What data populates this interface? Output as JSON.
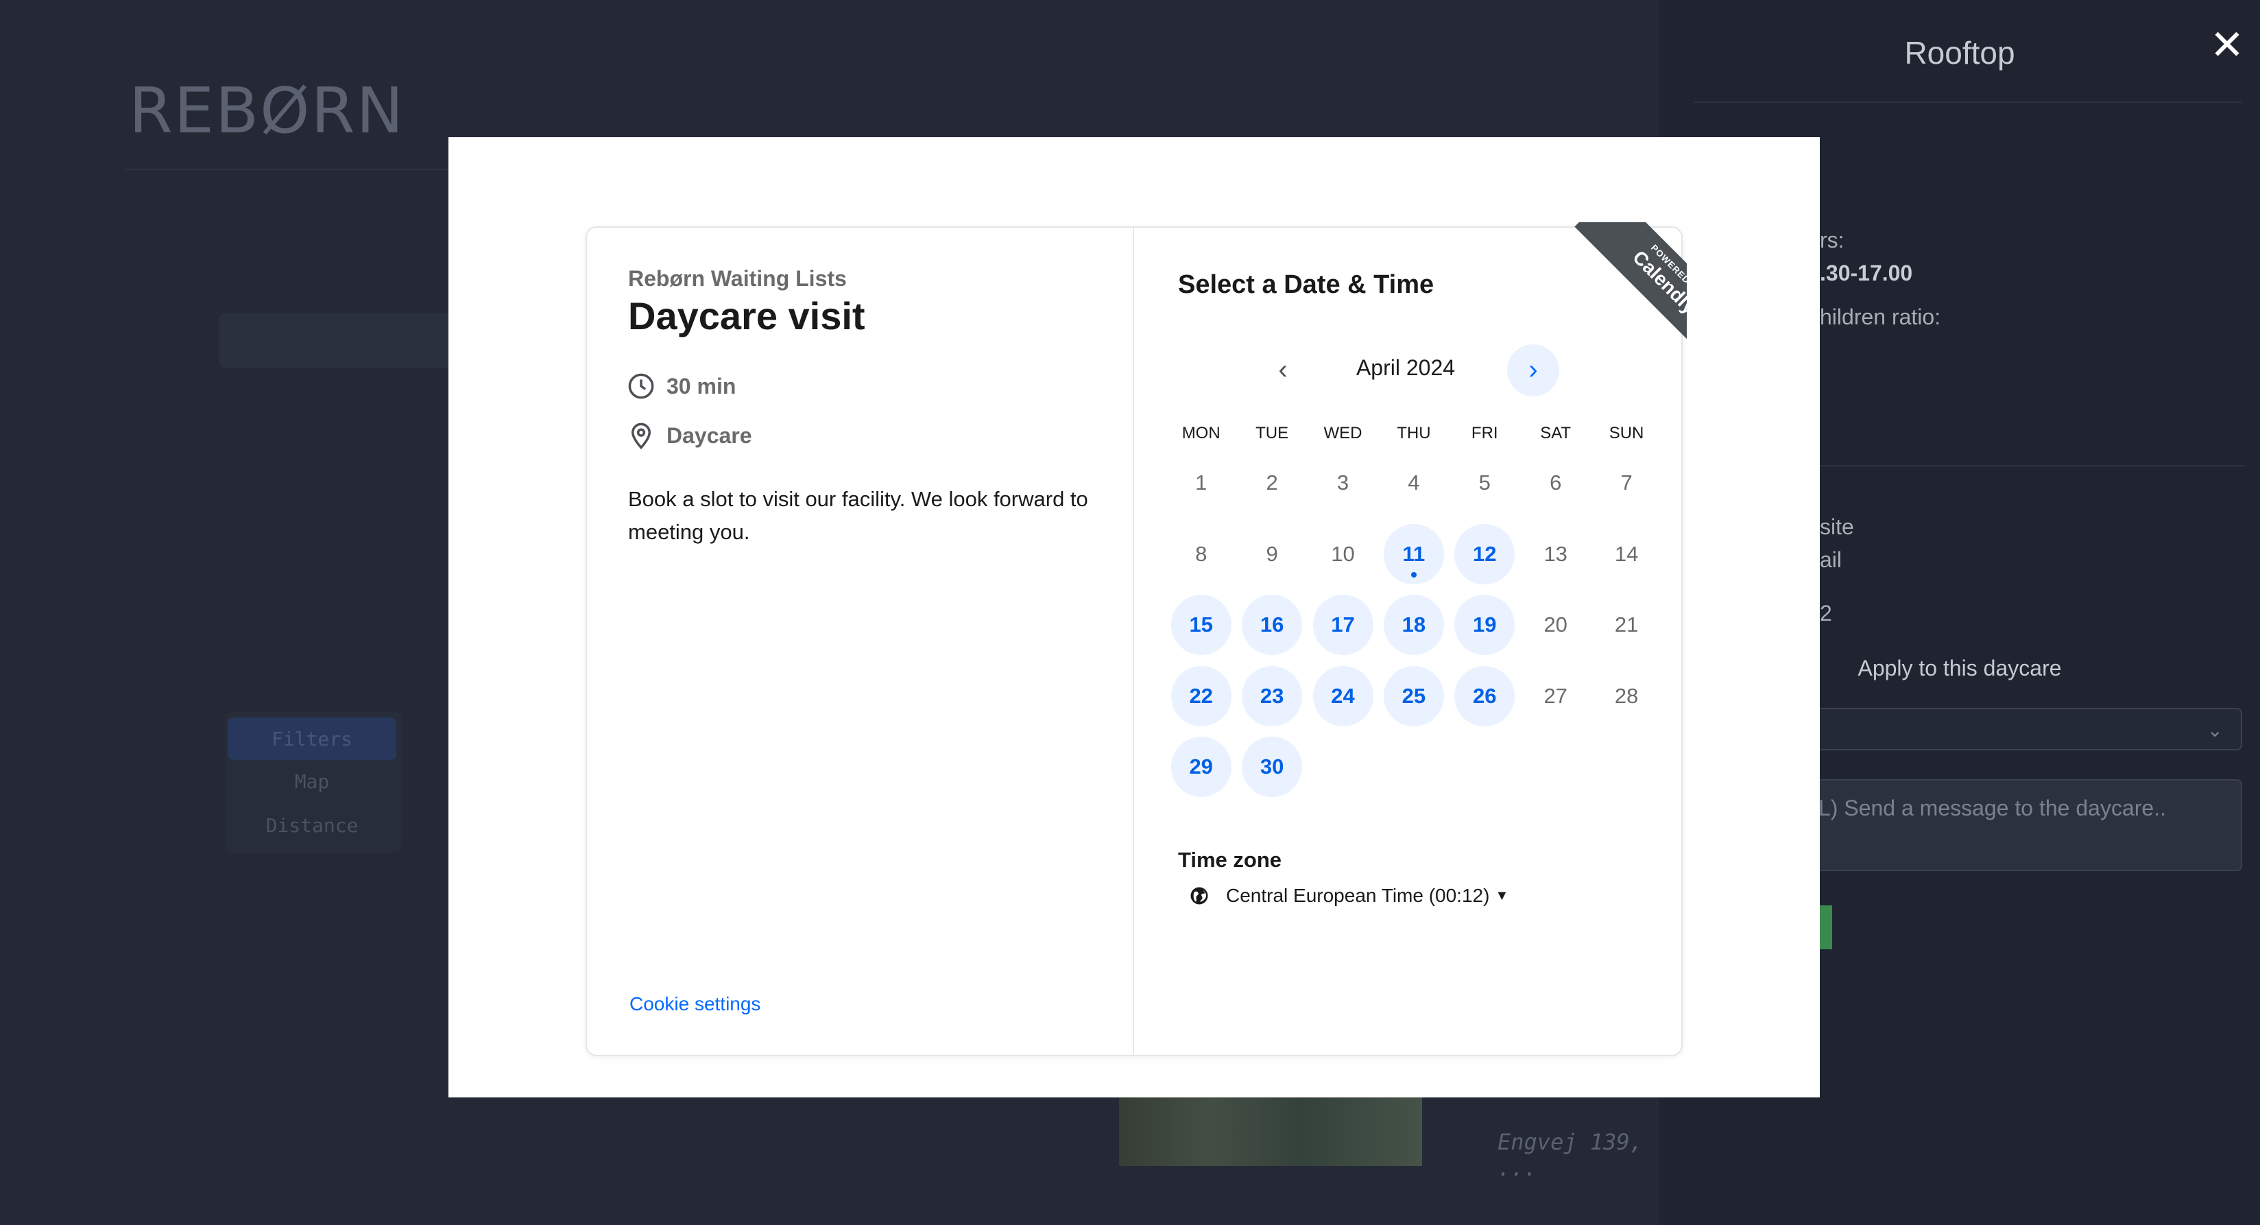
{
  "background": {
    "logo": "REBØRN",
    "side_nav": [
      "Filters",
      "Map",
      "Distance"
    ],
    "address": "Engvej 139, ..."
  },
  "drawer": {
    "title": "Rooftop",
    "close_icon": "close-icon",
    "hours_label": "rs:",
    "hours_value": ".30-17.00",
    "ratio_label": "hildren ratio:",
    "website_label": "site",
    "email_label": "ail",
    "count_label": "2",
    "apply_label": "Apply to this daycare",
    "message_placeholder": "L) Send a message to the daycare.."
  },
  "scheduler": {
    "org_name": "Rebørn Waiting Lists",
    "event_title": "Daycare visit",
    "duration": "30 min",
    "location": "Daycare",
    "description": "Book a slot to visit our facility. We look forward to meeting you.",
    "cookie_settings": "Cookie settings",
    "select_title": "Select a Date & Time",
    "ribbon_small": "POWERED BY",
    "ribbon_brand": "Calendly",
    "month": "April 2024",
    "prev_icon": "chevron-left-icon",
    "next_icon": "chevron-right-icon",
    "weekdays": [
      "MON",
      "TUE",
      "WED",
      "THU",
      "FRI",
      "SAT",
      "SUN"
    ],
    "days": [
      {
        "label": "1",
        "available": false
      },
      {
        "label": "2",
        "available": false
      },
      {
        "label": "3",
        "available": false
      },
      {
        "label": "4",
        "available": false
      },
      {
        "label": "5",
        "available": false
      },
      {
        "label": "6",
        "available": false
      },
      {
        "label": "7",
        "available": false
      },
      {
        "label": "8",
        "available": false
      },
      {
        "label": "9",
        "available": false
      },
      {
        "label": "10",
        "available": false
      },
      {
        "label": "11",
        "available": true,
        "today": true
      },
      {
        "label": "12",
        "available": true
      },
      {
        "label": "13",
        "available": false
      },
      {
        "label": "14",
        "available": false
      },
      {
        "label": "15",
        "available": true
      },
      {
        "label": "16",
        "available": true
      },
      {
        "label": "17",
        "available": true
      },
      {
        "label": "18",
        "available": true
      },
      {
        "label": "19",
        "available": true
      },
      {
        "label": "20",
        "available": false
      },
      {
        "label": "21",
        "available": false
      },
      {
        "label": "22",
        "available": true
      },
      {
        "label": "23",
        "available": true
      },
      {
        "label": "24",
        "available": true
      },
      {
        "label": "25",
        "available": true
      },
      {
        "label": "26",
        "available": true
      },
      {
        "label": "27",
        "available": false
      },
      {
        "label": "28",
        "available": false
      },
      {
        "label": "29",
        "available": true
      },
      {
        "label": "30",
        "available": true
      }
    ],
    "timezone_label": "Time zone",
    "timezone_value": "Central European Time (00:12)",
    "colors": {
      "accent": "#0069ff",
      "available_bg": "#eaf2ff"
    }
  }
}
